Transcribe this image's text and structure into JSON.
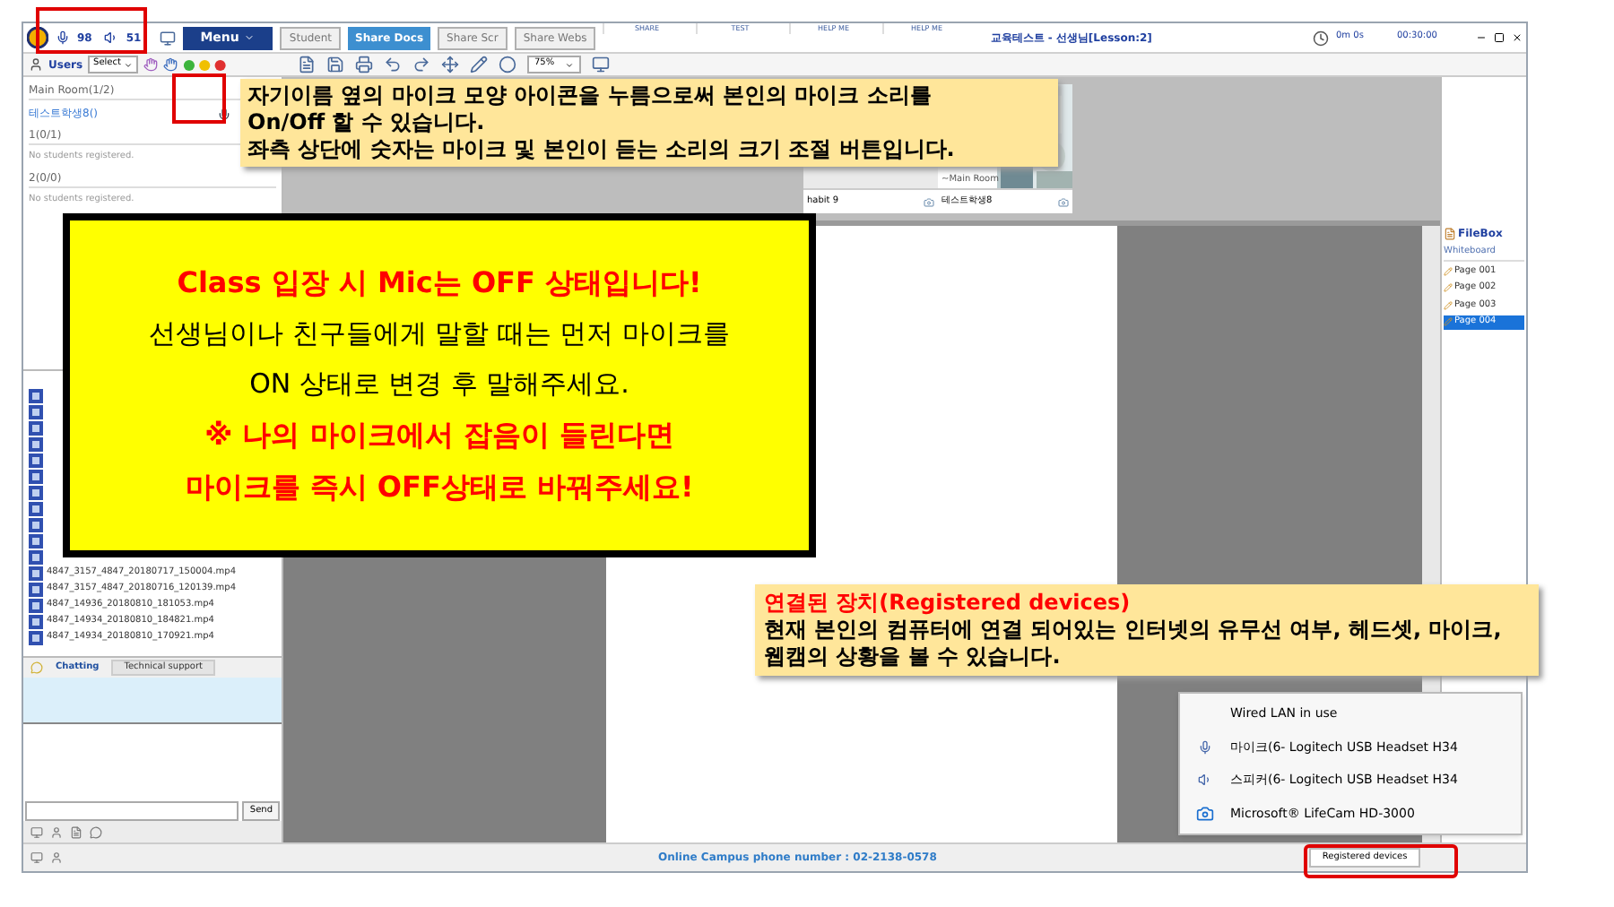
{
  "header": {
    "mic_level": "98",
    "speaker_level": "51",
    "menu": "Menu",
    "tabs": [
      {
        "label": "Student",
        "selected": false
      },
      {
        "label": "Share Docs",
        "selected": true
      },
      {
        "label": "Share Scr",
        "selected": false
      },
      {
        "label": "Share Webs",
        "selected": false
      }
    ],
    "tool_groups": [
      "SHARE",
      "TEST",
      "HELP ME",
      "HELP ME"
    ],
    "title": "교육테스트 - 선생님[Lesson:2]",
    "elapsed": "0m 0s",
    "remaining": "00:30:00"
  },
  "users_panel": {
    "title": "Users",
    "select": "Select",
    "rooms": [
      {
        "name": "Main Room(1/2)",
        "students": [
          "테스트학생8()"
        ]
      },
      {
        "name": "1(0/1)",
        "empty": "No students registered."
      },
      {
        "name": "2(0/0)",
        "empty": "No students registered."
      }
    ]
  },
  "toolbar": {
    "zoom": "75%"
  },
  "videos": [
    {
      "name": "habit 9"
    },
    {
      "room": "~Main Room",
      "name": "테스트학생8"
    }
  ],
  "files": [
    "4847_3157_4847_20180717_150004.mp4",
    "4847_3157_4847_20180716_120139.mp4",
    "4847_14936_20180810_181053.mp4",
    "4847_14934_20180810_184821.mp4",
    "4847_14934_20180810_170921.mp4"
  ],
  "chat": {
    "tabs": [
      {
        "label": "Chatting",
        "selected": true
      },
      {
        "label": "Technical support",
        "selected": false
      }
    ],
    "send": "Send"
  },
  "filebox": {
    "title": "FileBox",
    "section": "Whiteboard",
    "pages": [
      {
        "label": "Page 001",
        "selected": false
      },
      {
        "label": "Page 002",
        "selected": false
      },
      {
        "label": "Page 003",
        "selected": false
      },
      {
        "label": "Page 004",
        "selected": true
      }
    ]
  },
  "status_bar": {
    "phone": "Online Campus phone number : 02-2138-0578",
    "devices_button": "Registered devices"
  },
  "devices_popup": [
    {
      "kind": "network",
      "label": "Wired LAN in use"
    },
    {
      "kind": "mic",
      "label": "마이크(6- Logitech USB Headset H34"
    },
    {
      "kind": "speaker",
      "label": "스피커(6- Logitech USB Headset H34"
    },
    {
      "kind": "camera",
      "label": "Microsoft® LifeCam HD-3000"
    }
  ],
  "annotations": {
    "mic_callout": [
      "자기이름 옆의 마이크 모양 아이콘을 누름으로써 본인의 마이크 소리를",
      "On/Off 할 수 있습니다.",
      "좌측 상단에 숫자는 마이크 및 본인이 듣는 소리의 크기 조절 버튼입니다."
    ],
    "notice": [
      {
        "text": "Class 입장 시 Mic는 OFF 상태입니다!",
        "color": "#ff0000"
      },
      {
        "text": "선생님이나 친구들에게 말할 때는 먼저 마이크를",
        "color": "#000000"
      },
      {
        "text": "ON 상태로 변경 후 말해주세요.",
        "color": "#000000"
      },
      {
        "text": "※ 나의 마이크에서 잡음이 들린다면",
        "color": "#ff0000"
      },
      {
        "text": "마이크를 즉시 OFF상태로 바꿔주세요!",
        "color": "#ff0000"
      }
    ],
    "devices_callout": {
      "title": "연결된 장치(Registered devices)",
      "body": "현재 본인의 컴퓨터에 연결 되어있는 인터넷의 유무선 여부, 헤드셋, 마이크, 웹캠의 상황을 볼 수 있습니다."
    }
  }
}
